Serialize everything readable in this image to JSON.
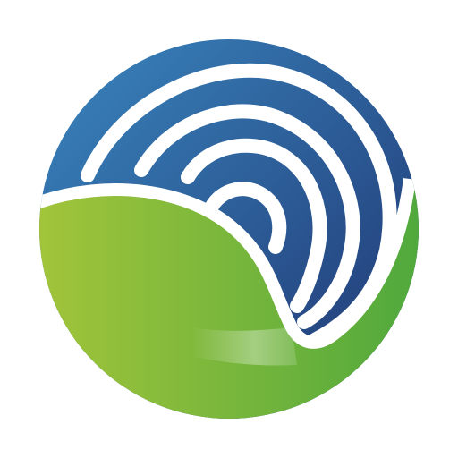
{
  "logo": {
    "icon": "signal-waves-globe-icon",
    "colors": {
      "blue_light": "#3a86bf",
      "blue_dark": "#1f3470",
      "green_light": "#a4c53a",
      "green_dark": "#4ea83d",
      "stroke": "#ffffff"
    }
  }
}
